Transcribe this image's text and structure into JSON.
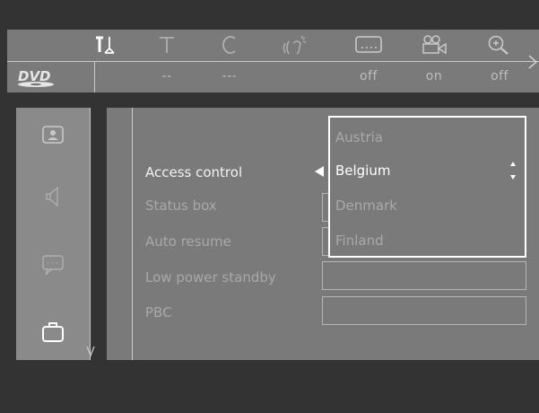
{
  "menu_bar": {
    "icons": [
      {
        "name": "setup-tools-icon",
        "active": true,
        "value": ""
      },
      {
        "name": "title-icon",
        "active": false,
        "value": "--"
      },
      {
        "name": "chapter-icon",
        "active": false,
        "value": "---"
      },
      {
        "name": "audio-icon",
        "active": false,
        "value": ""
      },
      {
        "name": "subtitle-icon",
        "active": false,
        "value": "off"
      },
      {
        "name": "angle-camera-icon",
        "active": false,
        "value": "on"
      },
      {
        "name": "zoom-icon",
        "active": false,
        "value": "off"
      }
    ],
    "logo": "DVD"
  },
  "side_menu": {
    "items": [
      {
        "name": "picture-icon",
        "selected": false
      },
      {
        "name": "sound-icon",
        "selected": false
      },
      {
        "name": "language-icon",
        "selected": false
      },
      {
        "name": "features-icon",
        "selected": true
      }
    ]
  },
  "settings": {
    "items": [
      {
        "label": "Access control",
        "active": true
      },
      {
        "label": "Status box",
        "active": false
      },
      {
        "label": "Auto resume",
        "active": false
      },
      {
        "label": "Low power standby",
        "active": false
      },
      {
        "label": "PBC",
        "active": false
      }
    ]
  },
  "country_dropdown": {
    "options": [
      "Austria",
      "Belgium",
      "Denmark",
      "Finland"
    ],
    "selected": "Belgium"
  },
  "colors": {
    "background": "#333333",
    "panel": "#7a7a7a",
    "text_active": "#ffffff",
    "text_inactive": "#a9a9a9"
  }
}
